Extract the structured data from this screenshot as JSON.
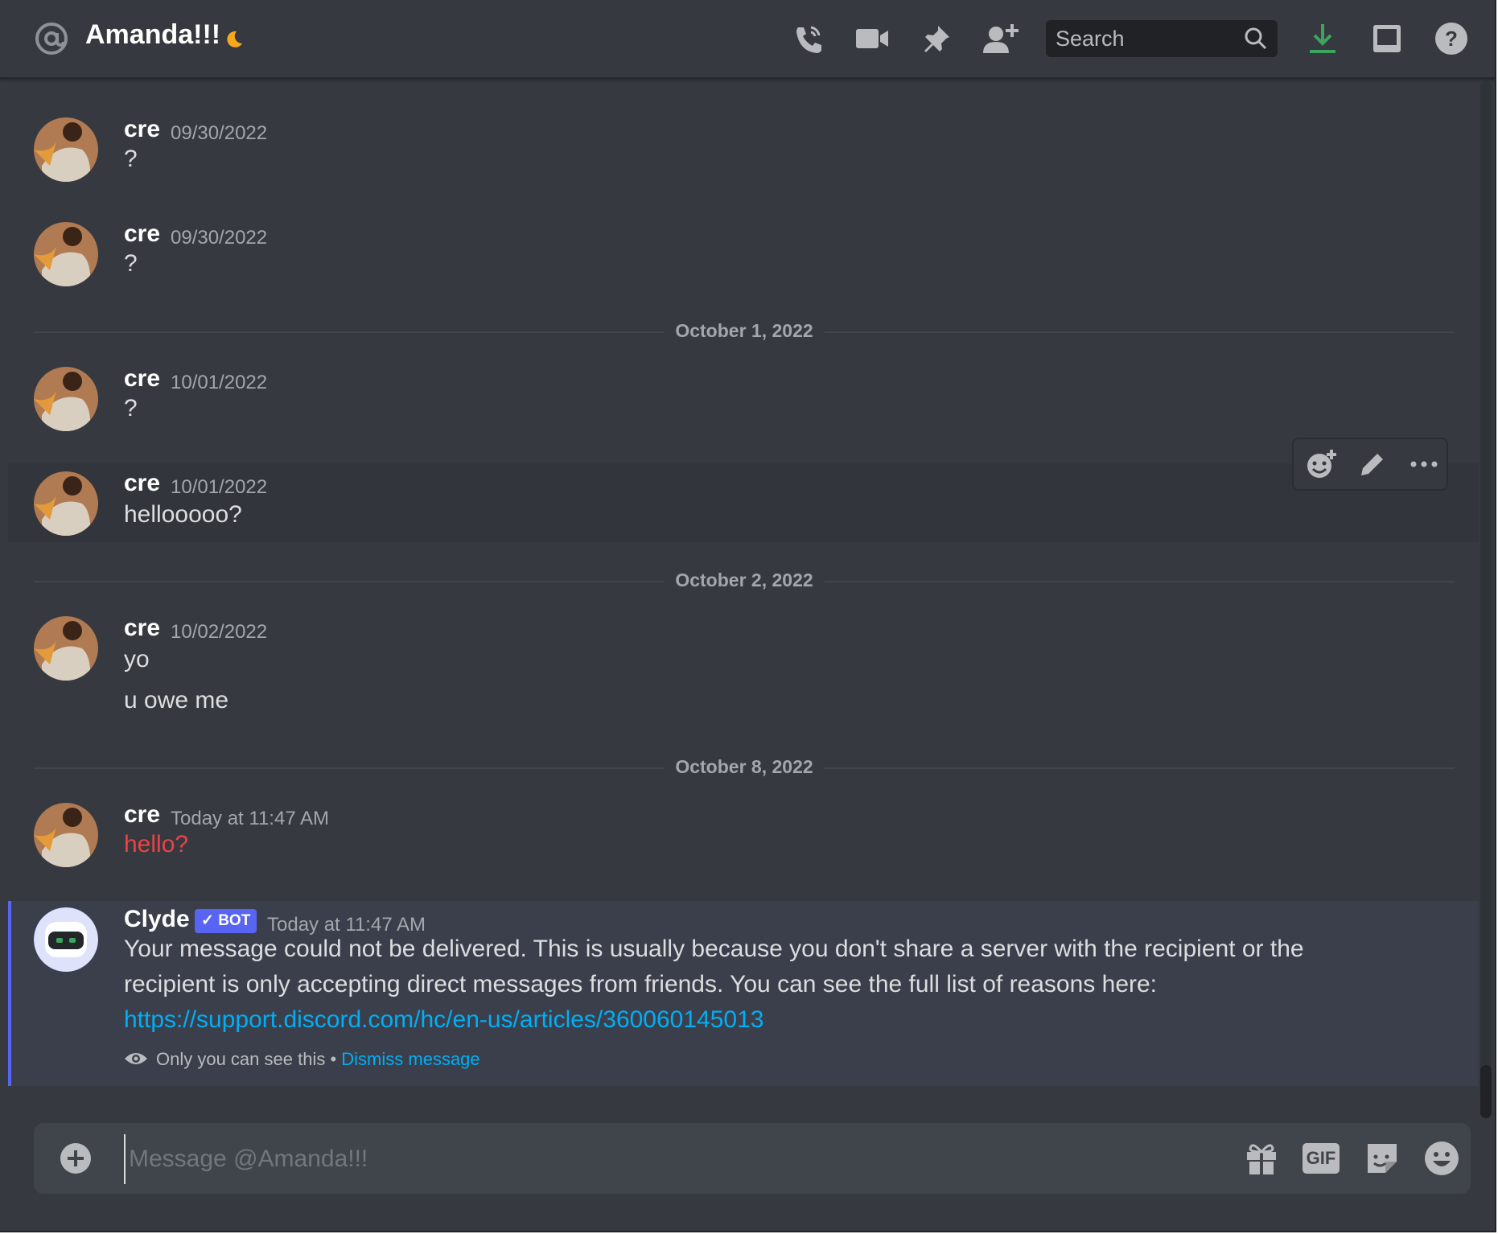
{
  "header": {
    "channel_name": "Amanda!!!",
    "search_placeholder": "Search",
    "icons": [
      "at-icon",
      "moon-icon",
      "call-icon",
      "video-icon",
      "pin-icon",
      "add-friend-icon",
      "search-icon",
      "download-icon",
      "inbox-icon",
      "help-icon"
    ],
    "download_color": "#3ba55d"
  },
  "dividers": [
    "October 1, 2022",
    "October 2, 2022",
    "October 8, 2022"
  ],
  "messages": [
    {
      "author": "cre",
      "time": "09/30/2022",
      "lines": [
        "?"
      ]
    },
    {
      "author": "cre",
      "time": "09/30/2022",
      "lines": [
        "?"
      ]
    },
    {
      "author": "cre",
      "time": "10/01/2022",
      "lines": [
        "?"
      ]
    },
    {
      "author": "cre",
      "time": "10/01/2022",
      "lines": [
        "hellooooo?"
      ]
    },
    {
      "author": "cre",
      "time": "10/02/2022",
      "lines": [
        "yo",
        "u owe me"
      ]
    },
    {
      "author": "cre",
      "time": "Today at 11:47 AM",
      "lines": [
        "hello?"
      ],
      "failed_color": "#ed4245"
    }
  ],
  "clyde": {
    "author": "Clyde",
    "badge": "✓ BOT",
    "time": "Today at 11:47 AM",
    "text_line1": "Your message could not be delivered. This is usually because you don't share a server with the recipient or the",
    "text_line2": "recipient is only accepting direct messages from friends. You can see the full list of reasons here:",
    "link": "https://support.discord.com/hc/en-us/articles/360060145013",
    "note": "Only you can see this •",
    "dismiss": "Dismiss message"
  },
  "toolbar": {
    "icons": [
      "add-reaction-icon",
      "edit-icon",
      "more-icon"
    ]
  },
  "composer": {
    "placeholder": "Message @Amanda!!!",
    "gif_label": "GIF",
    "icons": [
      "plus-icon",
      "gift-icon",
      "gif-icon",
      "sticker-icon",
      "emoji-icon"
    ]
  }
}
